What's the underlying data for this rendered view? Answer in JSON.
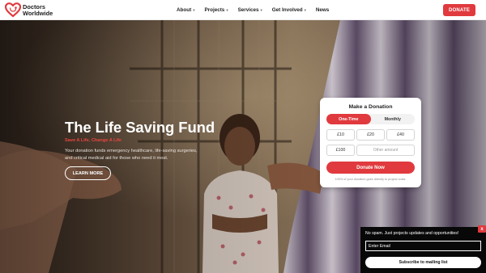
{
  "header": {
    "logo": {
      "line1": "Doctors",
      "line2": "Worldwide",
      "icon": "heart-stethoscope-icon",
      "color": "#e03a3e"
    },
    "nav": [
      {
        "label": "About",
        "has_dropdown": true
      },
      {
        "label": "Projects",
        "has_dropdown": true
      },
      {
        "label": "Services",
        "has_dropdown": true
      },
      {
        "label": "Get Involved",
        "has_dropdown": true
      },
      {
        "label": "News",
        "has_dropdown": false
      }
    ],
    "donate_label": "DONATE"
  },
  "hero": {
    "title": "The Life Saving Fund",
    "subtitle": "Save A Life, Change A Life",
    "body": "Your donation funds emergency healthcare, life-saving surgeries, and critical medical aid for those who need it most.",
    "cta_label": "LEARN MORE"
  },
  "donation": {
    "title": "Make a Donation",
    "frequency": {
      "one_time": "One-Time",
      "monthly": "Monthly",
      "selected": "One-Time"
    },
    "amounts": [
      "£10",
      "£20",
      "£40",
      "£100"
    ],
    "other_placeholder": "Other amount",
    "submit_label": "Donate Now",
    "note": "100% of your donation goes directly to project costs."
  },
  "newsletter": {
    "text": "No spam. Just projects updates and opportunities!",
    "email_placeholder": "Enter Email",
    "subscribe_label": "Subscribe to mailing list",
    "close_label": "x"
  },
  "colors": {
    "accent": "#e03a3e",
    "dark": "#080808"
  }
}
